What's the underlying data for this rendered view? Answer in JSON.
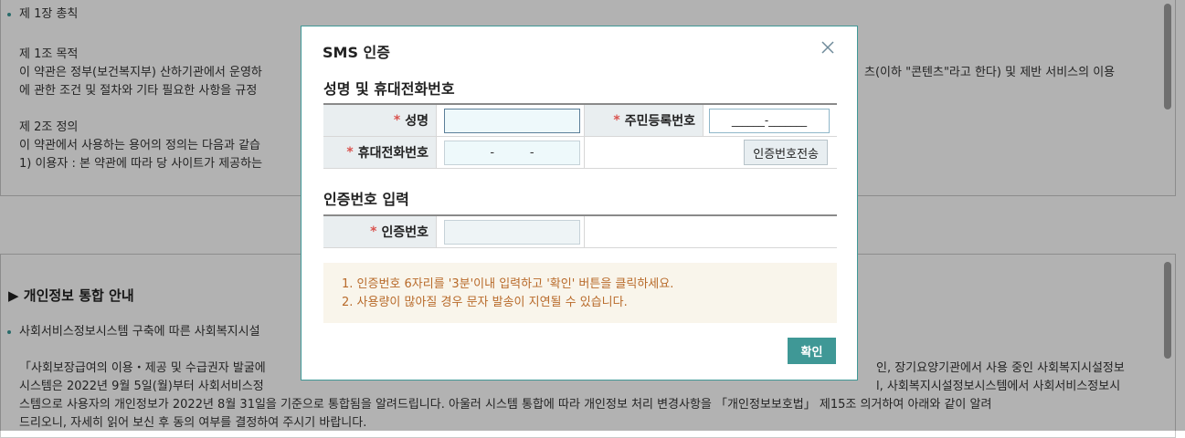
{
  "background": {
    "top_lines": [
      "제 1장 총칙",
      "제 1조 목적",
      "이 약관은 정부(보건복지부) 산하기관에서 운영하",
      "에 관한 조건 및 절차와 기타 필요한 사항을 규정",
      "제 2조 정의",
      "이 약관에서 사용하는 용어의 정의는 다음과 같습",
      "1) 이용자 : 본 약관에 따라 당 사이트가 제공하는"
    ],
    "top_right_fragment": "츠(이하 \"콘텐츠\"라고 한다) 및 제반 서비스의 이용",
    "section_title": "개인정보 통합 안내",
    "bottom_lines": [
      "사회서비스정보시스템 구축에 따른 사회복지시설",
      "「사회보장급여의 이용・제공 및 수급권자 발굴에",
      "시스템은 2022년 9월 5일(월)부터 사회서비스정",
      "스템으로 사용자의 개인정보가 2022년 8월 31일을 기준으로 통합됨을 알려드립니다. 아울러 시스템 통합에 따라 개인정보 처리 변경사항을 「개인정보보호법」 제15조 의거하여 아래와 같이 알려",
      "드리오니, 자세히 읽어 보신 후 동의 여부를 결정하여 주시기 바랍니다."
    ],
    "bottom_right_fragments": [
      "인, 장기요양기관에서 사용 중인 사회복지시설정보",
      "l, 사회복지시설정보시스템에서 사회서비스정보시"
    ]
  },
  "modal": {
    "title": "SMS 인증",
    "section1_title": "성명 및 휴대전화번호",
    "name_label": "성명",
    "ssn_label": "주민등록번호",
    "ssn_value": "______-_______",
    "phone_label": "휴대전화번호",
    "phone_sep1": "-",
    "phone_sep2": "-",
    "send_button": "인증번호전송",
    "section2_title": "인증번호 입력",
    "code_label": "인증번호",
    "notice_lines": [
      "1. 인증번호 6자리를 '3분'이내 입력하고 '확인' 버튼을 클릭하세요.",
      "2. 사용량이 많아질 경우 문자 발송이 지연될 수 있습니다."
    ],
    "confirm_button": "확인",
    "required_mark": "*"
  },
  "colors": {
    "accent": "#3f9896",
    "required": "#d9534f",
    "notice_text": "#b86a2a"
  },
  "icons": {
    "close": "close-icon",
    "section_marker": "triangle-right-icon"
  }
}
